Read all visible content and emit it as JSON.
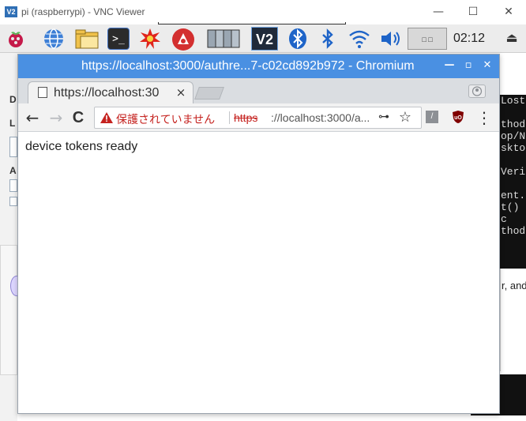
{
  "vnc": {
    "logo": "V2",
    "title": "pi (raspberrypi) - VNC Viewer",
    "minimize": "—",
    "maximize": "☐",
    "close": "✕"
  },
  "taskbar": {
    "clock": "02:12",
    "menu_arrow": "⏏",
    "terminal_prompt": ">_",
    "vnc_logo": "V2",
    "cpu_chart_label": "□ □"
  },
  "browser": {
    "window_title": "https://localhost:3000/authre...7-c02cd892b972 - Chromium",
    "win_minimize": "—",
    "win_maximize": "▫",
    "win_close": "✕",
    "tab_title": "https://localhost:30",
    "tab_close": "×",
    "nav_back": "←",
    "nav_forward": "→",
    "reload": "C",
    "security_text": "保護されていません",
    "url_scheme": "https",
    "url_rest": "://localhost:3000/a...",
    "key": "⊶",
    "star": "☆",
    "ext_label": "/",
    "menu": "⋮",
    "page_text": "device tokens ready"
  },
  "background": {
    "terminal_lines": [
      "Lost",
      "",
      "thod:",
      "op/No",
      "sktop",
      "",
      "Verif",
      "",
      "ent.",
      "t() c",
      "",
      "thod:"
    ],
    "panel_text": "r, and",
    "left_letters": [
      "D",
      "L",
      "A"
    ]
  },
  "colors": {
    "chromium_titlebar": "#4a90e2",
    "security_warning": "#c5221f",
    "panel_bg": "#ececec"
  }
}
